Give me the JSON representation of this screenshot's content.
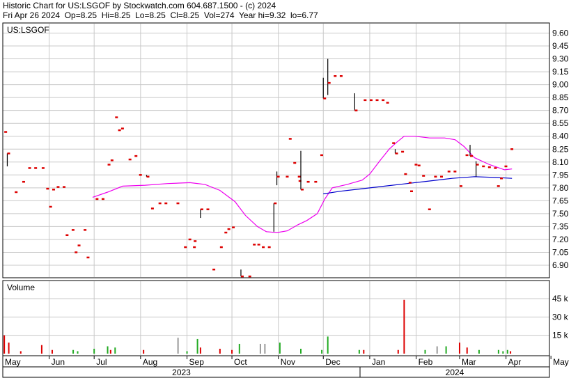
{
  "header": {
    "line1": "Historic Chart for US:LSGOF by Stockwatch.com 604.687.1500 - (c) 2024",
    "line2": "Fri Apr 26 2024  Op=8.25  Hi=8.25  Lo=8.25  Cl=8.25  Vol=274  Year hi=9.32  lo=6.77"
  },
  "colors": {
    "price": "#dd0000",
    "ma_short": "#ee00ee",
    "ma_long": "#0000cc",
    "grid": "#c8c8c8",
    "volume_red": "#dd0000",
    "volume_green": "#22aa22",
    "volume_gray": "#999999"
  },
  "chart_data": [
    {
      "type": "bar",
      "title": "US:LSGOF",
      "ylim": [
        6.77,
        9.7
      ],
      "y_ticks": [
        "9.60",
        "9.45",
        "9.30",
        "9.15",
        "9.00",
        "8.85",
        "8.70",
        "8.55",
        "8.40",
        "8.25",
        "8.10",
        "7.95",
        "7.80",
        "7.65",
        "7.50",
        "7.35",
        "7.20",
        "7.05",
        "6.90"
      ],
      "x_ticks": [
        "May",
        "Jun",
        "Jul",
        "Aug",
        "Sep",
        "Oct",
        "Nov",
        "Dec",
        "Jan",
        "Feb",
        "Mar",
        "Apr",
        "May"
      ],
      "years": [
        "2023",
        "2024"
      ],
      "x_range": [
        0,
        365
      ],
      "ohlc": [
        {
          "x": 1,
          "o": 8.45,
          "h": 8.45,
          "l": 8.45,
          "c": 8.45
        },
        {
          "x": 3,
          "o": 8.2,
          "h": 8.2,
          "l": 8.05,
          "c": 8.2
        },
        {
          "x": 8,
          "o": 7.75,
          "h": 7.75,
          "l": 7.75,
          "c": 7.75
        },
        {
          "x": 13,
          "o": 7.87,
          "h": 7.87,
          "l": 7.87,
          "c": 7.87
        },
        {
          "x": 17,
          "o": 8.03,
          "h": 8.03,
          "l": 8.03,
          "c": 8.03
        },
        {
          "x": 21,
          "o": 8.03,
          "h": 8.03,
          "l": 8.03,
          "c": 8.03
        },
        {
          "x": 26,
          "o": 8.03,
          "h": 8.03,
          "l": 8.03,
          "c": 8.03
        },
        {
          "x": 29,
          "o": 7.79,
          "h": 7.79,
          "l": 7.79,
          "c": 7.79
        },
        {
          "x": 31,
          "o": 7.58,
          "h": 7.58,
          "l": 7.58,
          "c": 7.58
        },
        {
          "x": 33,
          "o": 7.78,
          "h": 7.78,
          "l": 7.78,
          "c": 7.78
        },
        {
          "x": 36,
          "o": 7.81,
          "h": 7.81,
          "l": 7.81,
          "c": 7.81
        },
        {
          "x": 40,
          "o": 7.81,
          "h": 7.81,
          "l": 7.81,
          "c": 7.81
        },
        {
          "x": 42,
          "o": 7.25,
          "h": 7.25,
          "l": 7.25,
          "c": 7.25
        },
        {
          "x": 46,
          "o": 7.31,
          "h": 7.31,
          "l": 7.31,
          "c": 7.31
        },
        {
          "x": 48,
          "o": 7.05,
          "h": 7.05,
          "l": 7.05,
          "c": 7.05
        },
        {
          "x": 50,
          "o": 7.13,
          "h": 7.13,
          "l": 7.13,
          "c": 7.13
        },
        {
          "x": 54,
          "o": 7.31,
          "h": 7.31,
          "l": 7.31,
          "c": 7.31
        },
        {
          "x": 56,
          "o": 6.99,
          "h": 6.99,
          "l": 6.99,
          "c": 6.99
        },
        {
          "x": 62,
          "o": 7.67,
          "h": 7.67,
          "l": 7.67,
          "c": 7.67
        },
        {
          "x": 66,
          "o": 7.67,
          "h": 7.67,
          "l": 7.67,
          "c": 7.67
        },
        {
          "x": 70,
          "o": 8.07,
          "h": 8.07,
          "l": 8.07,
          "c": 8.07
        },
        {
          "x": 72,
          "o": 8.12,
          "h": 8.12,
          "l": 8.12,
          "c": 8.12
        },
        {
          "x": 75,
          "o": 8.62,
          "h": 8.62,
          "l": 8.62,
          "c": 8.62
        },
        {
          "x": 77,
          "o": 8.47,
          "h": 8.47,
          "l": 8.47,
          "c": 8.47
        },
        {
          "x": 79,
          "o": 8.49,
          "h": 8.49,
          "l": 8.49,
          "c": 8.49
        },
        {
          "x": 84,
          "o": 8.13,
          "h": 8.13,
          "l": 8.13,
          "c": 8.13
        },
        {
          "x": 88,
          "o": 8.17,
          "h": 8.17,
          "l": 8.17,
          "c": 8.17
        },
        {
          "x": 91,
          "o": 7.95,
          "h": 7.95,
          "l": 7.95,
          "c": 7.95
        },
        {
          "x": 96,
          "o": 7.95,
          "h": 7.95,
          "l": 7.93,
          "c": 7.93
        },
        {
          "x": 99,
          "o": 7.56,
          "h": 7.56,
          "l": 7.56,
          "c": 7.56
        },
        {
          "x": 104,
          "o": 7.62,
          "h": 7.62,
          "l": 7.62,
          "c": 7.62
        },
        {
          "x": 108,
          "o": 7.62,
          "h": 7.62,
          "l": 7.62,
          "c": 7.62
        },
        {
          "x": 116,
          "o": 7.62,
          "h": 7.62,
          "l": 7.62,
          "c": 7.62
        },
        {
          "x": 121,
          "o": 7.11,
          "h": 7.11,
          "l": 7.11,
          "c": 7.11
        },
        {
          "x": 124,
          "o": 7.2,
          "h": 7.2,
          "l": 7.2,
          "c": 7.2
        },
        {
          "x": 127,
          "o": 7.11,
          "h": 7.11,
          "l": 7.11,
          "c": 7.11
        },
        {
          "x": 127.5,
          "o": 7.18,
          "h": 7.18,
          "l": 7.18,
          "c": 7.18
        },
        {
          "x": 132,
          "o": 7.55,
          "h": 7.55,
          "l": 7.45,
          "c": 7.55
        },
        {
          "x": 136,
          "o": 7.55,
          "h": 7.55,
          "l": 7.55,
          "c": 7.55
        },
        {
          "x": 140,
          "o": 6.85,
          "h": 6.85,
          "l": 6.85,
          "c": 6.85
        },
        {
          "x": 145,
          "o": 7.11,
          "h": 7.11,
          "l": 7.11,
          "c": 7.11
        },
        {
          "x": 148,
          "o": 7.28,
          "h": 7.28,
          "l": 7.28,
          "c": 7.28
        },
        {
          "x": 150,
          "o": 7.32,
          "h": 7.32,
          "l": 7.32,
          "c": 7.32
        },
        {
          "x": 153,
          "o": 7.34,
          "h": 7.34,
          "l": 7.34,
          "c": 7.34
        },
        {
          "x": 159,
          "o": 6.77,
          "h": 6.85,
          "l": 6.77,
          "c": 6.77
        },
        {
          "x": 164,
          "o": 6.77,
          "h": 6.77,
          "l": 6.77,
          "c": 6.77
        },
        {
          "x": 167,
          "o": 7.14,
          "h": 7.14,
          "l": 7.14,
          "c": 7.14
        },
        {
          "x": 170,
          "o": 7.14,
          "h": 7.14,
          "l": 7.14,
          "c": 7.14
        },
        {
          "x": 173,
          "o": 7.11,
          "h": 7.11,
          "l": 7.11,
          "c": 7.11
        },
        {
          "x": 177,
          "o": 7.11,
          "h": 7.11,
          "l": 7.11,
          "c": 7.11
        },
        {
          "x": 181,
          "o": 7.62,
          "h": 7.62,
          "l": 7.29,
          "c": 7.62
        },
        {
          "x": 183,
          "o": 7.93,
          "h": 7.99,
          "l": 7.83,
          "c": 7.93
        },
        {
          "x": 189,
          "o": 7.93,
          "h": 7.93,
          "l": 7.93,
          "c": 7.93
        },
        {
          "x": 191,
          "o": 8.37,
          "h": 8.37,
          "l": 8.37,
          "c": 8.37
        },
        {
          "x": 194,
          "o": 8.09,
          "h": 8.09,
          "l": 8.09,
          "c": 8.09
        },
        {
          "x": 197,
          "o": 7.93,
          "h": 7.93,
          "l": 7.93,
          "c": 7.93
        },
        {
          "x": 197.5,
          "o": 7.88,
          "h": 7.88,
          "l": 7.88,
          "c": 7.88
        },
        {
          "x": 199,
          "o": 8.23,
          "h": 8.23,
          "l": 7.78,
          "c": 7.78
        },
        {
          "x": 203,
          "o": 7.87,
          "h": 7.87,
          "l": 7.87,
          "c": 7.87
        },
        {
          "x": 208,
          "o": 7.87,
          "h": 7.87,
          "l": 7.87,
          "c": 7.87
        },
        {
          "x": 212,
          "o": 8.18,
          "h": 8.18,
          "l": 8.18,
          "c": 8.18
        },
        {
          "x": 214,
          "o": 8.84,
          "h": 9.08,
          "l": 8.84,
          "c": 8.84
        },
        {
          "x": 217,
          "o": 9.02,
          "h": 9.3,
          "l": 8.88,
          "c": 9.02
        },
        {
          "x": 221,
          "o": 9.1,
          "h": 9.1,
          "l": 9.1,
          "c": 9.1
        },
        {
          "x": 225,
          "o": 9.1,
          "h": 9.1,
          "l": 9.1,
          "c": 9.1
        },
        {
          "x": 235,
          "o": 8.7,
          "h": 8.9,
          "l": 8.7,
          "c": 8.7
        },
        {
          "x": 241,
          "o": 8.82,
          "h": 8.82,
          "l": 8.82,
          "c": 8.82
        },
        {
          "x": 245,
          "o": 8.82,
          "h": 8.82,
          "l": 8.82,
          "c": 8.82
        },
        {
          "x": 249,
          "o": 8.82,
          "h": 8.82,
          "l": 8.82,
          "c": 8.82
        },
        {
          "x": 253,
          "o": 8.82,
          "h": 8.82,
          "l": 8.82,
          "c": 8.82
        },
        {
          "x": 256,
          "o": 8.79,
          "h": 8.79,
          "l": 8.79,
          "c": 8.79
        },
        {
          "x": 260,
          "o": 8.32,
          "h": 8.32,
          "l": 8.32,
          "c": 8.32
        },
        {
          "x": 262,
          "o": 8.25,
          "h": 8.25,
          "l": 8.2,
          "c": 8.2
        },
        {
          "x": 266,
          "o": 8.22,
          "h": 8.22,
          "l": 8.22,
          "c": 8.22
        },
        {
          "x": 268,
          "o": 7.96,
          "h": 7.96,
          "l": 7.96,
          "c": 7.96
        },
        {
          "x": 271,
          "o": 7.86,
          "h": 7.86,
          "l": 7.86,
          "c": 7.86
        },
        {
          "x": 272,
          "o": 7.76,
          "h": 7.76,
          "l": 7.76,
          "c": 7.76
        },
        {
          "x": 275,
          "o": 8.07,
          "h": 8.07,
          "l": 8.07,
          "c": 8.07
        },
        {
          "x": 277,
          "o": 8.06,
          "h": 8.06,
          "l": 8.06,
          "c": 8.06
        },
        {
          "x": 280,
          "o": 7.94,
          "h": 7.94,
          "l": 7.94,
          "c": 7.94
        },
        {
          "x": 284,
          "o": 7.55,
          "h": 7.55,
          "l": 7.55,
          "c": 7.55
        },
        {
          "x": 288,
          "o": 7.93,
          "h": 7.93,
          "l": 7.93,
          "c": 7.93
        },
        {
          "x": 292,
          "o": 7.93,
          "h": 7.93,
          "l": 7.93,
          "c": 7.93
        },
        {
          "x": 297,
          "o": 7.99,
          "h": 7.99,
          "l": 7.99,
          "c": 7.99
        },
        {
          "x": 301,
          "o": 7.99,
          "h": 7.99,
          "l": 7.99,
          "c": 7.99
        },
        {
          "x": 305,
          "o": 7.82,
          "h": 7.82,
          "l": 7.82,
          "c": 7.82
        },
        {
          "x": 309,
          "o": 8.18,
          "h": 8.18,
          "l": 8.18,
          "c": 8.18
        },
        {
          "x": 312,
          "o": 8.17,
          "h": 8.3,
          "l": 8.17,
          "c": 8.17
        },
        {
          "x": 316,
          "o": 8.07,
          "h": 8.11,
          "l": 7.93,
          "c": 8.07
        },
        {
          "x": 320,
          "o": 8.05,
          "h": 8.05,
          "l": 8.05,
          "c": 8.05
        },
        {
          "x": 324,
          "o": 8.04,
          "h": 8.04,
          "l": 8.04,
          "c": 8.04
        },
        {
          "x": 328,
          "o": 8.03,
          "h": 8.03,
          "l": 8.03,
          "c": 8.03
        },
        {
          "x": 330,
          "o": 7.82,
          "h": 7.82,
          "l": 7.82,
          "c": 7.82
        },
        {
          "x": 332,
          "o": 7.91,
          "h": 7.91,
          "l": 7.91,
          "c": 7.91
        },
        {
          "x": 335,
          "o": 8.05,
          "h": 8.05,
          "l": 8.05,
          "c": 8.05
        },
        {
          "x": 339,
          "o": 8.25,
          "h": 8.25,
          "l": 8.25,
          "c": 8.25
        }
      ],
      "series": [
        {
          "values_xy": [
            [
              60,
              7.69
            ],
            [
              70,
              7.75
            ],
            [
              80,
              7.82
            ],
            [
              95,
              7.83
            ],
            [
              110,
              7.85
            ],
            [
              125,
              7.86
            ],
            [
              135,
              7.84
            ],
            [
              145,
              7.77
            ],
            [
              155,
              7.64
            ],
            [
              162,
              7.48
            ],
            [
              170,
              7.35
            ],
            [
              176,
              7.29
            ],
            [
              183,
              7.28
            ],
            [
              190,
              7.3
            ],
            [
              197,
              7.37
            ],
            [
              203,
              7.42
            ],
            [
              210,
              7.5
            ],
            [
              215,
              7.67
            ],
            [
              220,
              7.8
            ],
            [
              230,
              7.84
            ],
            [
              240,
              7.89
            ],
            [
              245,
              7.96
            ],
            [
              252,
              8.12
            ],
            [
              258,
              8.25
            ],
            [
              263,
              8.33
            ],
            [
              268,
              8.4
            ],
            [
              275,
              8.4
            ],
            [
              285,
              8.38
            ],
            [
              295,
              8.38
            ],
            [
              302,
              8.36
            ],
            [
              308,
              8.28
            ],
            [
              315,
              8.15
            ],
            [
              325,
              8.07
            ],
            [
              335,
              8.01
            ],
            [
              340,
              8.02
            ]
          ]
        },
        {
          "values_xy": [
            [
              214,
              7.73
            ],
            [
              225,
              7.76
            ],
            [
              240,
              7.79
            ],
            [
              255,
              7.82
            ],
            [
              270,
              7.85
            ],
            [
              285,
              7.88
            ],
            [
              300,
              7.91
            ],
            [
              315,
              7.93
            ],
            [
              330,
              7.92
            ],
            [
              340,
              7.91
            ]
          ]
        }
      ]
    },
    {
      "type": "bar",
      "title": "Volume",
      "ylim": [
        0,
        50000
      ],
      "y_ticks": [
        "45 k",
        "30 k",
        "15 k"
      ],
      "bars": [
        {
          "x": 1,
          "v": 15000,
          "c": "r"
        },
        {
          "x": 4,
          "v": 9000,
          "c": "r"
        },
        {
          "x": 12,
          "v": 2000,
          "c": "r"
        },
        {
          "x": 26,
          "v": 7000,
          "c": "r"
        },
        {
          "x": 33,
          "v": 3000,
          "c": "r"
        },
        {
          "x": 47,
          "v": 3000,
          "c": "g"
        },
        {
          "x": 50,
          "v": 2000,
          "c": "g"
        },
        {
          "x": 61,
          "v": 4000,
          "c": "g"
        },
        {
          "x": 70,
          "v": 6000,
          "c": "g"
        },
        {
          "x": 72,
          "v": 3000,
          "c": "r"
        },
        {
          "x": 75,
          "v": 5000,
          "c": "g"
        },
        {
          "x": 94,
          "v": 3000,
          "c": "r"
        },
        {
          "x": 117,
          "v": 13000,
          "c": "x"
        },
        {
          "x": 123,
          "v": 2000,
          "c": "g"
        },
        {
          "x": 130,
          "v": 12000,
          "c": "g"
        },
        {
          "x": 132,
          "v": 5000,
          "c": "r"
        },
        {
          "x": 145,
          "v": 4000,
          "c": "r"
        },
        {
          "x": 153,
          "v": 3000,
          "c": "r"
        },
        {
          "x": 158,
          "v": 8000,
          "c": "g"
        },
        {
          "x": 172,
          "v": 8000,
          "c": "x"
        },
        {
          "x": 175,
          "v": 8000,
          "c": "x"
        },
        {
          "x": 185,
          "v": 9000,
          "c": "g"
        },
        {
          "x": 199,
          "v": 4000,
          "c": "g"
        },
        {
          "x": 213,
          "v": 3000,
          "c": "g"
        },
        {
          "x": 217,
          "v": 14000,
          "c": "g"
        },
        {
          "x": 238,
          "v": 3000,
          "c": "g"
        },
        {
          "x": 241,
          "v": 3000,
          "c": "r"
        },
        {
          "x": 264,
          "v": 3000,
          "c": "r"
        },
        {
          "x": 268,
          "v": 44000,
          "c": "r"
        },
        {
          "x": 282,
          "v": 3000,
          "c": "g"
        },
        {
          "x": 290,
          "v": 6000,
          "c": "x"
        },
        {
          "x": 296,
          "v": 6000,
          "c": "g"
        },
        {
          "x": 305,
          "v": 9000,
          "c": "r"
        },
        {
          "x": 310,
          "v": 5000,
          "c": "r"
        },
        {
          "x": 318,
          "v": 3000,
          "c": "g"
        },
        {
          "x": 331,
          "v": 3000,
          "c": "g"
        },
        {
          "x": 334,
          "v": 2000,
          "c": "g"
        },
        {
          "x": 337,
          "v": 3000,
          "c": "g"
        },
        {
          "x": 339,
          "v": 2000,
          "c": "r"
        }
      ]
    }
  ]
}
